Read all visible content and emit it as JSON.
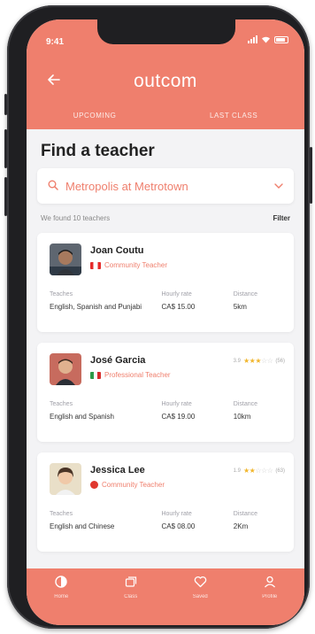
{
  "status_bar": {
    "time": "9:41"
  },
  "header": {
    "back_icon": "arrow-left-icon",
    "brand": "outcom",
    "tabs": [
      {
        "label": "UPCOMING"
      },
      {
        "label": "LAST CLASS"
      }
    ]
  },
  "search": {
    "title": "Find a teacher",
    "location": "Metropolis at Metrotown",
    "results_text": "We found 10 teachers",
    "filter_label": "Filter"
  },
  "columns": {
    "teaches": "Teaches",
    "hourly_rate": "Hourly rate",
    "distance": "Distance"
  },
  "teachers": [
    {
      "name": "Joan Coutu",
      "role": "Community Teacher",
      "teaches": "English, Spanish and Punjabi",
      "rate": "CA$ 15.00",
      "distance": "5km"
    },
    {
      "name": "José Garcia",
      "role": "Professional Teacher",
      "rating": "3.9",
      "stars": 3,
      "reviews": "(56)",
      "teaches": "English and Spanish",
      "rate": "CA$ 19.00",
      "distance": "10km"
    },
    {
      "name": "Jessica Lee",
      "role": "Community Teacher",
      "rating": "1.9",
      "stars": 2,
      "reviews": "(63)",
      "teaches": "English and Chinese",
      "rate": "CA$ 08.00",
      "distance": "2Km"
    }
  ],
  "tabbar": [
    {
      "label": "Home",
      "icon": "home-icon"
    },
    {
      "label": "Class",
      "icon": "class-icon"
    },
    {
      "label": "Saved",
      "icon": "heart-icon"
    },
    {
      "label": "Profile",
      "icon": "profile-icon"
    }
  ],
  "colors": {
    "accent": "#ef7f6d",
    "background": "#f3f3f5",
    "star": "#f1b62d"
  }
}
